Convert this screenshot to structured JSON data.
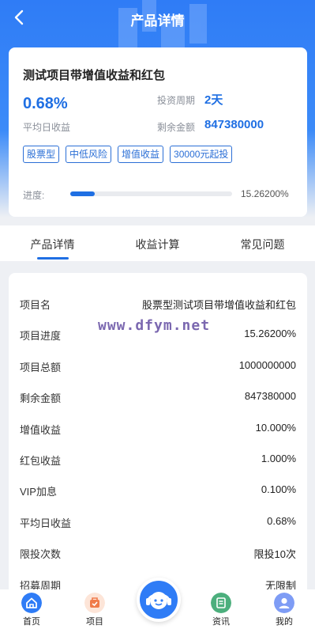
{
  "header": {
    "title": "产品详情"
  },
  "summary": {
    "name": "测试项目带增值收益和红包",
    "rate": "0.68%",
    "rate_label": "平均日收益",
    "period_label": "投资周期",
    "period_value": "2天",
    "remain_label": "剩余金额",
    "remain_value": "847380000",
    "tags": [
      "股票型",
      "中低风险",
      "增值收益",
      "30000元起投"
    ],
    "progress_label": "进度:",
    "progress_text": "15.26200%",
    "progress_fraction": 0.1526
  },
  "tabs": [
    {
      "label": "产品详情",
      "active": true
    },
    {
      "label": "收益计算",
      "active": false
    },
    {
      "label": "常见问题",
      "active": false
    }
  ],
  "details": [
    {
      "key": "项目名",
      "value": "股票型测试项目带增值收益和红包"
    },
    {
      "key": "项目进度",
      "value": "15.26200%"
    },
    {
      "key": "项目总额",
      "value": "1000000000"
    },
    {
      "key": "剩余金额",
      "value": "847380000"
    },
    {
      "key": "增值收益",
      "value": "10.000%"
    },
    {
      "key": "红包收益",
      "value": "1.000%"
    },
    {
      "key": "VIP加息",
      "value": "0.100%"
    },
    {
      "key": "平均日收益",
      "value": "0.68%"
    },
    {
      "key": "限投次数",
      "value": "限投10次"
    },
    {
      "key": "招募周期",
      "value": "无限制"
    }
  ],
  "watermark": "www.dfym.net",
  "nav": [
    {
      "label": "首页",
      "icon": "home-icon",
      "color": "#2f7cf6"
    },
    {
      "label": "项目",
      "icon": "project-icon",
      "color": "#f07b4a"
    },
    {
      "label": "",
      "icon": "support-icon",
      "color": "#2f7cf6"
    },
    {
      "label": "资讯",
      "icon": "news-icon",
      "color": "#4caf7d"
    },
    {
      "label": "我的",
      "icon": "profile-icon",
      "color": "#7e9cf5"
    }
  ],
  "colors": {
    "brand": "#2f7cf6",
    "accent_text": "#1f6fe3"
  }
}
